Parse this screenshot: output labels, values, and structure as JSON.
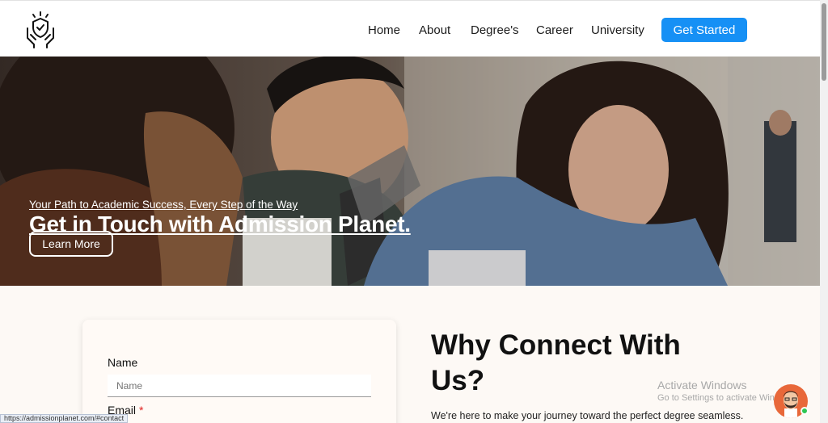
{
  "header": {
    "nav": [
      {
        "label": "Home"
      },
      {
        "label": "About"
      },
      {
        "label": "Degree's"
      },
      {
        "label": "Career"
      },
      {
        "label": "University"
      }
    ],
    "cta_label": "Get Started"
  },
  "hero": {
    "title": "Get in Touch with Admission Planet.",
    "subtitle": "Your Path to Academic Success, Every Step of the Way",
    "button_label": "Learn More"
  },
  "form": {
    "name_label": "Name",
    "name_placeholder": "Name",
    "email_label": "Email",
    "required_mark": "*"
  },
  "why": {
    "title": "Why Connect With Us?",
    "text": "We're here to make your journey toward the perfect degree seamless."
  },
  "watermark": {
    "line1": "Activate Windows",
    "line2": "Go to Settings to activate Windows."
  },
  "status_url": "https://admissionplanet.com/#contact",
  "colors": {
    "accent": "#1690f5",
    "page_bg": "#fdf9f5",
    "chat_bg": "#e8683a",
    "online": "#2dc653"
  },
  "icons": [
    "logo-shield-hands-icon",
    "chat-avatar-icon"
  ]
}
